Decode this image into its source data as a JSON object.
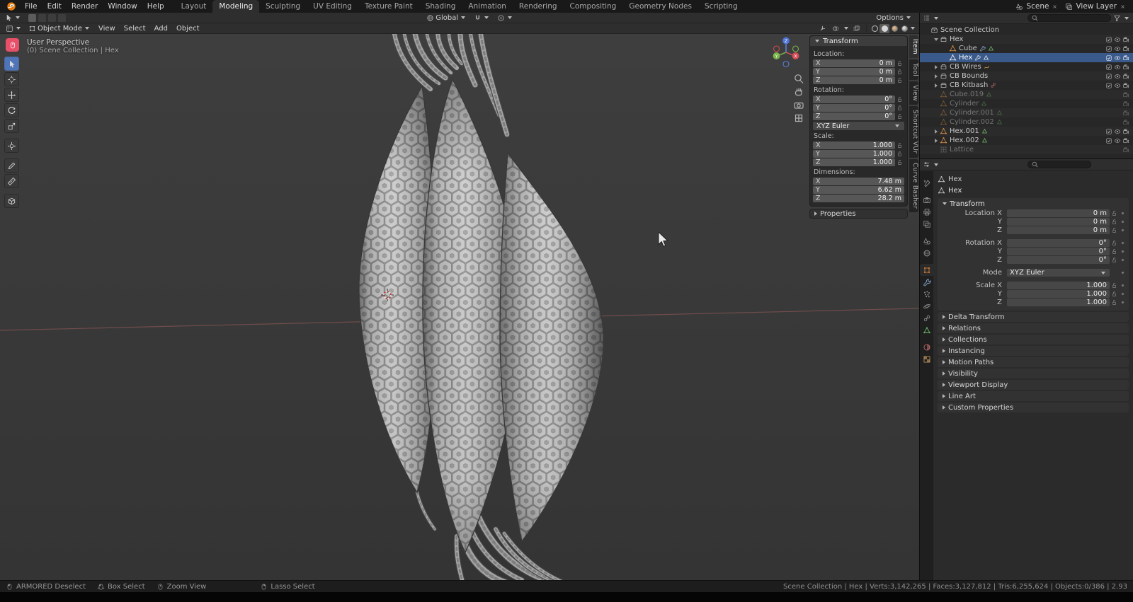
{
  "topbar": {
    "menus": [
      "File",
      "Edit",
      "Render",
      "Window",
      "Help"
    ],
    "workspaces": [
      "Layout",
      "Modeling",
      "Sculpting",
      "UV Editing",
      "Texture Paint",
      "Shading",
      "Animation",
      "Rendering",
      "Compositing",
      "Geometry Nodes",
      "Scripting"
    ],
    "active_workspace": "Modeling",
    "scene_name": "Scene",
    "view_layer_name": "View Layer"
  },
  "tool_settings": {
    "orientation": "Global",
    "options_label": "Options"
  },
  "viewport_header": {
    "mode": "Object Mode",
    "menus": [
      "View",
      "Select",
      "Add",
      "Object"
    ]
  },
  "viewport": {
    "perspective_label": "User Perspective",
    "context_label": "(0) Scene Collection | Hex"
  },
  "toolbar": {
    "tools": [
      {
        "icon": "tweak-select",
        "active": true
      },
      {
        "icon": "cursor"
      },
      {
        "icon": "move"
      },
      {
        "icon": "rotate"
      },
      {
        "icon": "scale"
      },
      {
        "icon": "transform",
        "gap": true
      },
      {
        "icon": "annotate",
        "gap": true
      },
      {
        "icon": "measure"
      },
      {
        "icon": "add-cube",
        "gap": true
      }
    ]
  },
  "n_panel": {
    "tabs": [
      "Item",
      "Tool",
      "View",
      "Shortcut VUr",
      "Curve Basher"
    ],
    "active_tab": "Item",
    "transform_title": "Transform",
    "groups": [
      {
        "label": "Location:",
        "locks": true,
        "rows": [
          {
            "axis": "X",
            "value": "0 m"
          },
          {
            "axis": "Y",
            "value": "0 m"
          },
          {
            "axis": "Z",
            "value": "0 m"
          }
        ]
      },
      {
        "label": "Rotation:",
        "locks": true,
        "rows": [
          {
            "axis": "X",
            "value": "0°"
          },
          {
            "axis": "Y",
            "value": "0°"
          },
          {
            "axis": "Z",
            "value": "0°"
          }
        ],
        "dropdown": "XYZ Euler"
      },
      {
        "label": "Scale:",
        "locks": true,
        "rows": [
          {
            "axis": "X",
            "value": "1.000"
          },
          {
            "axis": "Y",
            "value": "1.000"
          },
          {
            "axis": "Z",
            "value": "1.000"
          }
        ]
      },
      {
        "label": "Dimensions:",
        "locks": false,
        "rows": [
          {
            "axis": "X",
            "value": "7.48 m"
          },
          {
            "axis": "Y",
            "value": "6.62 m"
          },
          {
            "axis": "Z",
            "value": "28.2 m"
          }
        ]
      }
    ],
    "collapsed_panels": [
      "Properties"
    ]
  },
  "outliner": {
    "rows": [
      {
        "label": "Scene Collection",
        "icon": "scene-collection",
        "level": 0,
        "controls": []
      },
      {
        "label": "Hex",
        "icon": "collection",
        "level": 1,
        "arrow": "open",
        "controls": [
          "checkbox",
          "eye",
          "camera"
        ]
      },
      {
        "label": "Cube",
        "icon": "object-mesh",
        "level": 2,
        "badges": [
          "modifier",
          "mesh-data"
        ],
        "controls": [
          "checkbox",
          "eye",
          "camera"
        ]
      },
      {
        "label": "Hex",
        "icon": "object-mesh",
        "level": 2,
        "selected": true,
        "badges": [
          "modifier",
          "mesh-data"
        ],
        "controls": [
          "checkbox",
          "eye",
          "camera"
        ]
      },
      {
        "label": "CB Wires",
        "icon": "collection",
        "level": 1,
        "arrow": "closed",
        "badges": [
          "curve-data"
        ],
        "controls": [
          "checkbox",
          "eye",
          "camera"
        ]
      },
      {
        "label": "CB Bounds",
        "icon": "collection",
        "level": 1,
        "arrow": "closed",
        "badges": [],
        "controls": [
          "checkbox",
          "eye",
          "camera"
        ]
      },
      {
        "label": "CB Kitbash",
        "icon": "collection",
        "level": 1,
        "arrow": "closed",
        "badges": [
          "link"
        ],
        "controls": [
          "checkbox",
          "eye",
          "camera"
        ]
      },
      {
        "label": "Cube.019",
        "icon": "object-mesh",
        "level": 1,
        "dimmed": true,
        "badges": [
          "mesh-data"
        ],
        "controls": [
          "camera"
        ]
      },
      {
        "label": "Cylinder",
        "icon": "object-mesh",
        "level": 1,
        "dimmed": true,
        "badges": [
          "mesh-data"
        ],
        "controls": [
          "camera"
        ]
      },
      {
        "label": "Cylinder.001",
        "icon": "object-mesh",
        "level": 1,
        "dimmed": true,
        "badges": [
          "mesh-data"
        ],
        "controls": [
          "camera"
        ]
      },
      {
        "label": "Cylinder.002",
        "icon": "object-mesh",
        "level": 1,
        "dimmed": true,
        "badges": [
          "mesh-data"
        ],
        "controls": [
          "camera"
        ]
      },
      {
        "label": "Hex.001",
        "icon": "object-mesh",
        "level": 1,
        "arrow": "closed",
        "badges": [
          "mesh-data"
        ],
        "controls": [
          "checkbox",
          "eye",
          "camera"
        ]
      },
      {
        "label": "Hex.002",
        "icon": "object-mesh",
        "level": 1,
        "arrow": "closed",
        "badges": [
          "mesh-data"
        ],
        "controls": [
          "checkbox",
          "eye",
          "camera"
        ]
      },
      {
        "label": "Lattice",
        "icon": "lattice",
        "level": 1,
        "dimmed": true,
        "badges": [],
        "controls": [
          "camera"
        ]
      }
    ]
  },
  "properties": {
    "tabs": [
      {
        "icon": "tool"
      },
      {
        "icon": "render",
        "gap": true
      },
      {
        "icon": "output"
      },
      {
        "icon": "view-layer"
      },
      {
        "icon": "scene",
        "gap": true
      },
      {
        "icon": "world"
      },
      {
        "icon": "object",
        "active": true,
        "gap": true
      },
      {
        "icon": "modifiers"
      },
      {
        "icon": "particles"
      },
      {
        "icon": "physics"
      },
      {
        "icon": "constraints"
      },
      {
        "icon": "data"
      },
      {
        "icon": "material",
        "gap": true
      },
      {
        "icon": "texture"
      }
    ],
    "breadcrumb": "Hex",
    "object_name": "Hex",
    "transform_title": "Transform",
    "transform_rows": [
      {
        "label": "Location X",
        "value": "0 m",
        "type": "field"
      },
      {
        "label": "Y",
        "value": "0 m",
        "type": "field"
      },
      {
        "label": "Z",
        "value": "0 m",
        "type": "field",
        "gap": true
      },
      {
        "label": "Rotation X",
        "value": "0°",
        "type": "field"
      },
      {
        "label": "Y",
        "value": "0°",
        "type": "field"
      },
      {
        "label": "Z",
        "value": "0°",
        "type": "field",
        "gap": true
      },
      {
        "label": "Mode",
        "value": "XYZ Euler",
        "type": "dropdown",
        "gap": true
      },
      {
        "label": "Scale X",
        "value": "1.000",
        "type": "field"
      },
      {
        "label": "Y",
        "value": "1.000",
        "type": "field"
      },
      {
        "label": "Z",
        "value": "1.000",
        "type": "field"
      }
    ],
    "collapsed_panels": [
      "Delta Transform",
      "Relations",
      "Collections",
      "Instancing",
      "Motion Paths",
      "Visibility",
      "Viewport Display",
      "Line Art",
      "Custom Properties"
    ]
  },
  "status_bar": {
    "left": [
      {
        "icon": "mouse-l",
        "label": "ARMORED Deselect"
      },
      {
        "icon": "mouse-drag",
        "label": "Box Select"
      },
      {
        "icon": "mouse-m",
        "label": "Zoom View"
      },
      {
        "icon": "mouse-r",
        "label": "Lasso Select"
      }
    ],
    "right": "Scene Collection | Hex | Verts:3,142,265 | Faces:3,127,812 | Tris:6,255,624 | Objects:0/386 | 2.93"
  }
}
